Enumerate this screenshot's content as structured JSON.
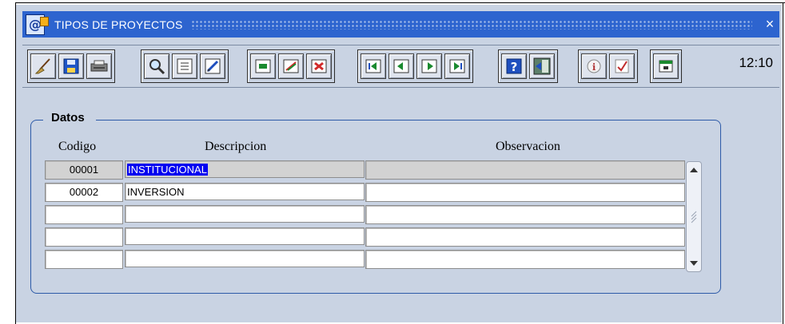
{
  "window": {
    "title": "TIPOS DE PROYECTOS",
    "close_glyph": "×"
  },
  "toolbar": {
    "groups": [
      [
        "broom-icon",
        "save-icon",
        "printer-icon"
      ],
      [
        "search-icon",
        "list-icon",
        "edit-icon"
      ],
      [
        "insert-record-icon",
        "duplicate-record-icon",
        "delete-record-icon"
      ],
      [
        "first-record-icon",
        "previous-record-icon",
        "next-record-icon",
        "last-record-icon"
      ],
      [
        "help-icon",
        "exit-icon"
      ],
      [
        "info-icon",
        "check-icon"
      ],
      [
        "calendar-icon"
      ]
    ],
    "clock": "12:10"
  },
  "block": {
    "label": "Datos",
    "columns": {
      "codigo": "Codigo",
      "descripcion": "Descripcion",
      "observacion": "Observacion"
    },
    "rows": [
      {
        "codigo": "00001",
        "descripcion": "INSTITUCIONAL",
        "observacion": ""
      },
      {
        "codigo": "00002",
        "descripcion": "INVERSION",
        "observacion": ""
      },
      {
        "codigo": "",
        "descripcion": "",
        "observacion": ""
      },
      {
        "codigo": "",
        "descripcion": "",
        "observacion": ""
      },
      {
        "codigo": "",
        "descripcion": "",
        "observacion": ""
      }
    ]
  },
  "colors": {
    "titlebar": "#2d64cf",
    "background": "#c9d3e3",
    "selection": "#0000f0"
  }
}
